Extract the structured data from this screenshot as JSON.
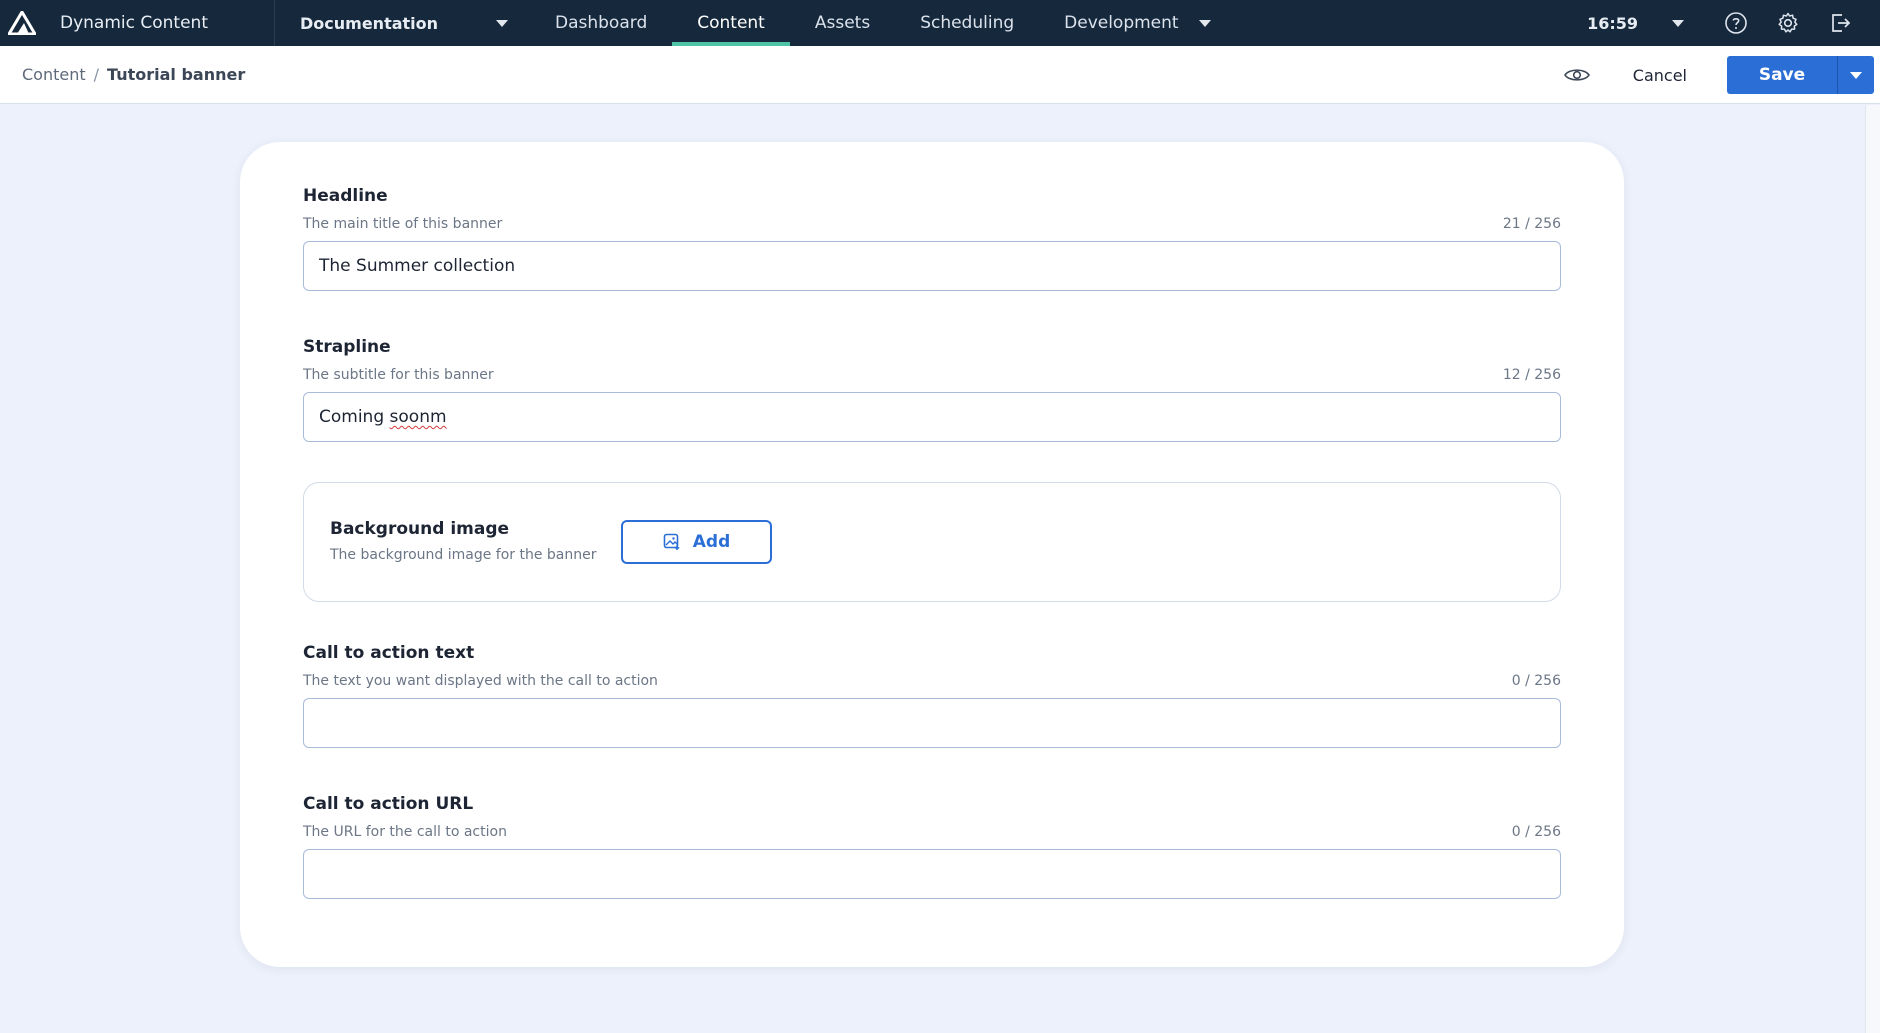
{
  "app": {
    "name": "Dynamic Content"
  },
  "nav": {
    "hub": "Documentation",
    "tabs": [
      {
        "label": "Dashboard",
        "active": false
      },
      {
        "label": "Content",
        "active": true
      },
      {
        "label": "Assets",
        "active": false
      },
      {
        "label": "Scheduling",
        "active": false
      },
      {
        "label": "Development",
        "active": false,
        "dropdown": true
      }
    ],
    "time": "16:59",
    "icons": [
      "help-icon",
      "settings-icon",
      "logout-icon"
    ],
    "accent": "#4fc3a5"
  },
  "breadcrumb": {
    "parent": "Content",
    "separator": "/",
    "current": "Tutorial banner"
  },
  "toolbar": {
    "preview_icon": "eye-icon",
    "cancel_label": "Cancel",
    "save_label": "Save",
    "save_color": "#2b6fd6"
  },
  "form": {
    "headline": {
      "label": "Headline",
      "help": "The main title of this banner",
      "count": "21 / 256",
      "value": "The Summer collection"
    },
    "strapline": {
      "label": "Strapline",
      "help": "The subtitle for this banner",
      "count": "12 / 256",
      "value_prefix": "Coming ",
      "value_misspelled": "soonm"
    },
    "background_image": {
      "label": "Background image",
      "help": "The background image for the banner",
      "add_label": "Add"
    },
    "cta_text": {
      "label": "Call to action text",
      "help": "The text you want displayed with the call to action",
      "count": "0 / 256",
      "value": ""
    },
    "cta_url": {
      "label": "Call to action URL",
      "help": "The URL for the call to action",
      "count": "0 / 256",
      "value": ""
    }
  }
}
